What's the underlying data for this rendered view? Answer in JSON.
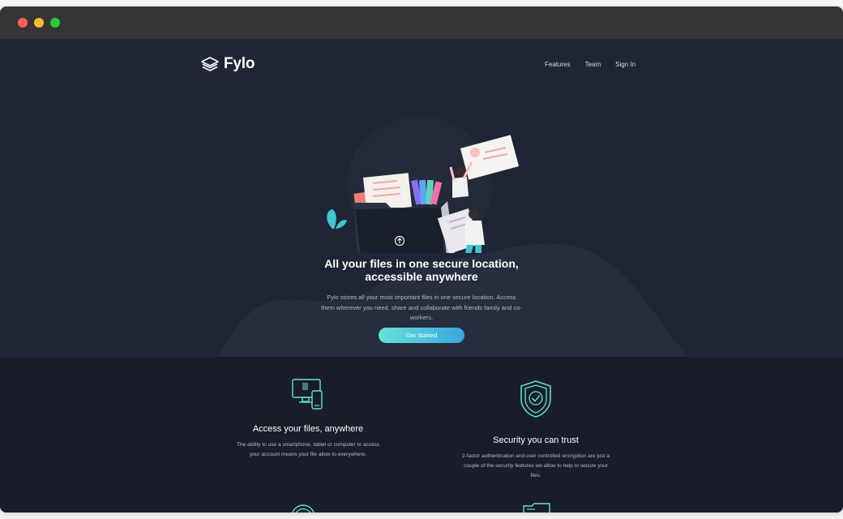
{
  "window": {
    "controls": [
      "close",
      "minimize",
      "maximize"
    ]
  },
  "nav": {
    "logo_text": "Fylo",
    "links": [
      "Features",
      "Team",
      "Sign In"
    ]
  },
  "hero": {
    "headline": "All your files in one secure location, accessible anywhere",
    "lead": "Fylo stores all your most important files in one secure location. Access them wherever you need, share and collaborate with friends family and co-workers.",
    "cta_label": "Get Started"
  },
  "features": [
    {
      "icon": "devices-icon",
      "title": "Access your files, anywhere",
      "description": "The ability to use a smartphone, tablet or computer to access your account means your file allow to everywhere."
    },
    {
      "icon": "shield-check-icon",
      "title": "Security you can trust",
      "description": "2-factor authentication and user controlled encryption are just a couple of the security features we allow to help to secure your files."
    }
  ],
  "colors": {
    "background": "#1c2230",
    "hero_background": "#1f2536",
    "accent_teal": "#65e1db",
    "accent_blue": "#3aa6dc",
    "text_muted": "#b5bac6"
  }
}
